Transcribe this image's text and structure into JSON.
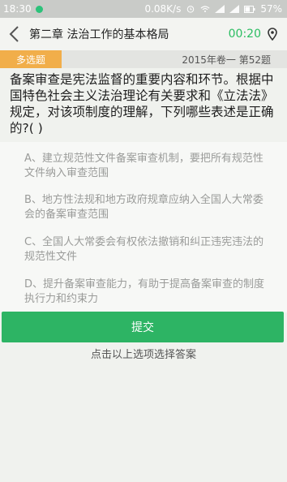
{
  "status_bar": {
    "time": "18:30",
    "network_speed": "0.08K/s",
    "battery": "57%",
    "icons": [
      "chat-bubble-icon",
      "alarm-icon",
      "wifi-icon",
      "signal-icon",
      "signal-icon",
      "battery-icon"
    ]
  },
  "header": {
    "title": "第二章 法治工作的基本格局",
    "timer": "00:20",
    "timer_color": "#2bbd62"
  },
  "meta": {
    "type_badge": "多选题",
    "badge_color": "#f1ae4a",
    "source": "2015年卷一 第52题"
  },
  "question": {
    "text": "备案审查是宪法监督的重要内容和环节。根据中国特色社会主义法治理论有关要求和《立法法》规定，对该项制度的理解，下列哪些表述是正确的?(    )"
  },
  "options": [
    {
      "text": "A、建立规范性文件备案审查机制，要把所有规范性文件纳入审查范围"
    },
    {
      "text": "B、地方性法规和地方政府规章应纳入全国人大常委会的备案审查范围"
    },
    {
      "text": "C、全国人大常委会有权依法撤销和纠正违宪违法的规范性文件"
    },
    {
      "text": "D、提升备案审查能力，有助于提高备案审查的制度执行力和约束力"
    }
  ],
  "submit": {
    "label": "提交",
    "color": "#2db464"
  },
  "hint": "点击以上选项选择答案"
}
